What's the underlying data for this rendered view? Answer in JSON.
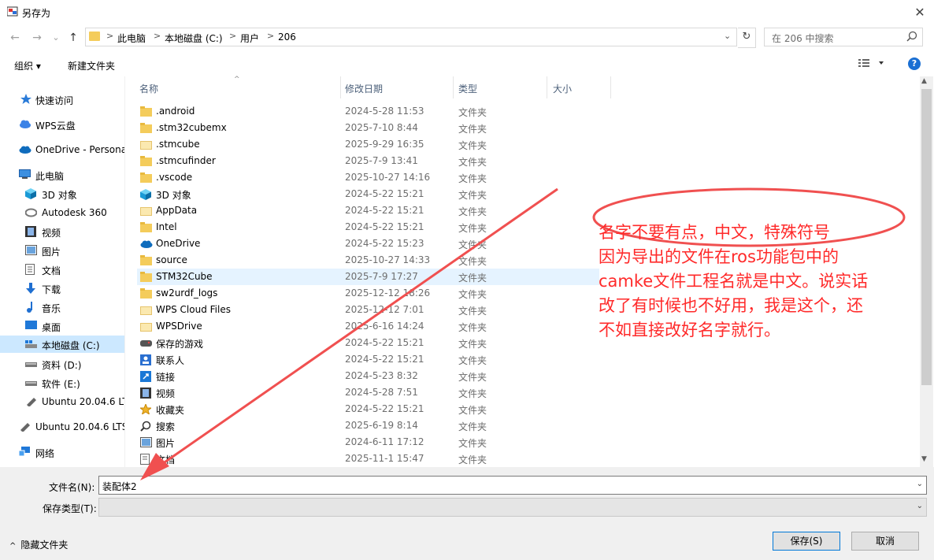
{
  "window": {
    "title": "另存为",
    "close_glyph": "✕"
  },
  "nav": {
    "back": "←",
    "forward": "→",
    "recent": "⌄",
    "up": "↑"
  },
  "address": {
    "crumbs": [
      "此电脑",
      "本地磁盘 (C:)",
      "用户",
      "206"
    ],
    "separator": ">",
    "dropdown": "⌄",
    "refresh": "↻"
  },
  "search": {
    "placeholder": "在 206 中搜索"
  },
  "toolbar": {
    "organize": "组织 ▾",
    "new_folder": "新建文件夹",
    "help": "?"
  },
  "sidebar": {
    "items": [
      {
        "label": "快速访问",
        "icon": "star-icon"
      },
      {
        "label": "WPS云盘",
        "icon": "cloud-icon"
      },
      {
        "label": "OneDrive - Persona",
        "icon": "onedrive-icon"
      },
      {
        "label": "此电脑",
        "icon": "computer-icon"
      },
      {
        "label": "3D 对象",
        "icon": "cube-icon"
      },
      {
        "label": "Autodesk 360",
        "icon": "autodesk-icon"
      },
      {
        "label": "视频",
        "icon": "video-icon"
      },
      {
        "label": "图片",
        "icon": "picture-icon"
      },
      {
        "label": "文档",
        "icon": "document-icon"
      },
      {
        "label": "下载",
        "icon": "download-icon"
      },
      {
        "label": "音乐",
        "icon": "music-icon"
      },
      {
        "label": "桌面",
        "icon": "desktop-icon"
      },
      {
        "label": "本地磁盘 (C:)",
        "icon": "drive-icon",
        "selected": true
      },
      {
        "label": "资料 (D:)",
        "icon": "drive-icon"
      },
      {
        "label": "软件 (E:)",
        "icon": "drive-icon"
      },
      {
        "label": "Ubuntu 20.04.6 LT",
        "icon": "usb-icon"
      },
      {
        "label": "Ubuntu 20.04.6 LTS",
        "icon": "usb-icon"
      },
      {
        "label": "网络",
        "icon": "network-icon"
      }
    ]
  },
  "columns": {
    "name": "名称",
    "modified": "修改日期",
    "type": "类型",
    "size": "大小"
  },
  "files": [
    {
      "name": ".android",
      "date": "2024-5-28 11:53",
      "type": "文件夹",
      "icon": "folder-icon"
    },
    {
      "name": ".stm32cubemx",
      "date": "2025-7-10 8:44",
      "type": "文件夹",
      "icon": "folder-icon"
    },
    {
      "name": ".stmcube",
      "date": "2025-9-29 16:35",
      "type": "文件夹",
      "icon": "folder-light-icon"
    },
    {
      "name": ".stmcufinder",
      "date": "2025-7-9 13:41",
      "type": "文件夹",
      "icon": "folder-icon"
    },
    {
      "name": ".vscode",
      "date": "2025-10-27 14:16",
      "type": "文件夹",
      "icon": "folder-icon"
    },
    {
      "name": "3D 对象",
      "date": "2024-5-22 15:21",
      "type": "文件夹",
      "icon": "cube-icon"
    },
    {
      "name": "AppData",
      "date": "2024-5-22 15:21",
      "type": "文件夹",
      "icon": "folder-light-icon"
    },
    {
      "name": "Intel",
      "date": "2024-5-22 15:21",
      "type": "文件夹",
      "icon": "folder-icon"
    },
    {
      "name": "OneDrive",
      "date": "2024-5-22 15:23",
      "type": "文件夹",
      "icon": "onedrive-icon"
    },
    {
      "name": "source",
      "date": "2025-10-27 14:33",
      "type": "文件夹",
      "icon": "folder-icon"
    },
    {
      "name": "STM32Cube",
      "date": "2025-7-9 17:27",
      "type": "文件夹",
      "icon": "folder-icon",
      "selected": true
    },
    {
      "name": "sw2urdf_logs",
      "date": "2025-12-12 18:26",
      "type": "文件夹",
      "icon": "folder-icon"
    },
    {
      "name": "WPS Cloud Files",
      "date": "2025-12-12 7:01",
      "type": "文件夹",
      "icon": "folder-light-icon"
    },
    {
      "name": "WPSDrive",
      "date": "2025-6-16 14:24",
      "type": "文件夹",
      "icon": "folder-light-icon"
    },
    {
      "name": "保存的游戏",
      "date": "2024-5-22 15:21",
      "type": "文件夹",
      "icon": "game-icon"
    },
    {
      "name": "联系人",
      "date": "2024-5-22 15:21",
      "type": "文件夹",
      "icon": "contacts-icon"
    },
    {
      "name": "链接",
      "date": "2024-5-23 8:32",
      "type": "文件夹",
      "icon": "link-icon"
    },
    {
      "name": "视频",
      "date": "2024-5-28 7:51",
      "type": "文件夹",
      "icon": "video-icon"
    },
    {
      "name": "收藏夹",
      "date": "2024-5-22 15:21",
      "type": "文件夹",
      "icon": "star-icon"
    },
    {
      "name": "搜索",
      "date": "2025-6-19 8:14",
      "type": "文件夹",
      "icon": "search-icon"
    },
    {
      "name": "图片",
      "date": "2024-6-11 17:12",
      "type": "文件夹",
      "icon": "picture-icon"
    },
    {
      "name": "文档",
      "date": "2025-11-1 15:47",
      "type": "文件夹",
      "icon": "document-icon"
    }
  ],
  "filename": {
    "label": "文件名(N):",
    "value": "装配体2"
  },
  "filetype": {
    "label": "保存类型(T):",
    "value": ""
  },
  "footer": {
    "hide_folders": "隐藏文件夹",
    "save": "保存(S)",
    "cancel": "取消"
  },
  "annotation": {
    "lines": [
      "名字不要有点，中文，特殊符号",
      "因为导出的文件在ros功能包中的",
      "camke文件工程名就是中文。说实话",
      "改了有时候也不好用，我是这个，还",
      "不如直接改好名字就行。"
    ],
    "color": "#ff2a2a"
  },
  "colors": {
    "selection": "#cce8ff",
    "row_selection": "#e5f3ff",
    "folder": "#f4cc5b",
    "accent": "#0078d7"
  }
}
